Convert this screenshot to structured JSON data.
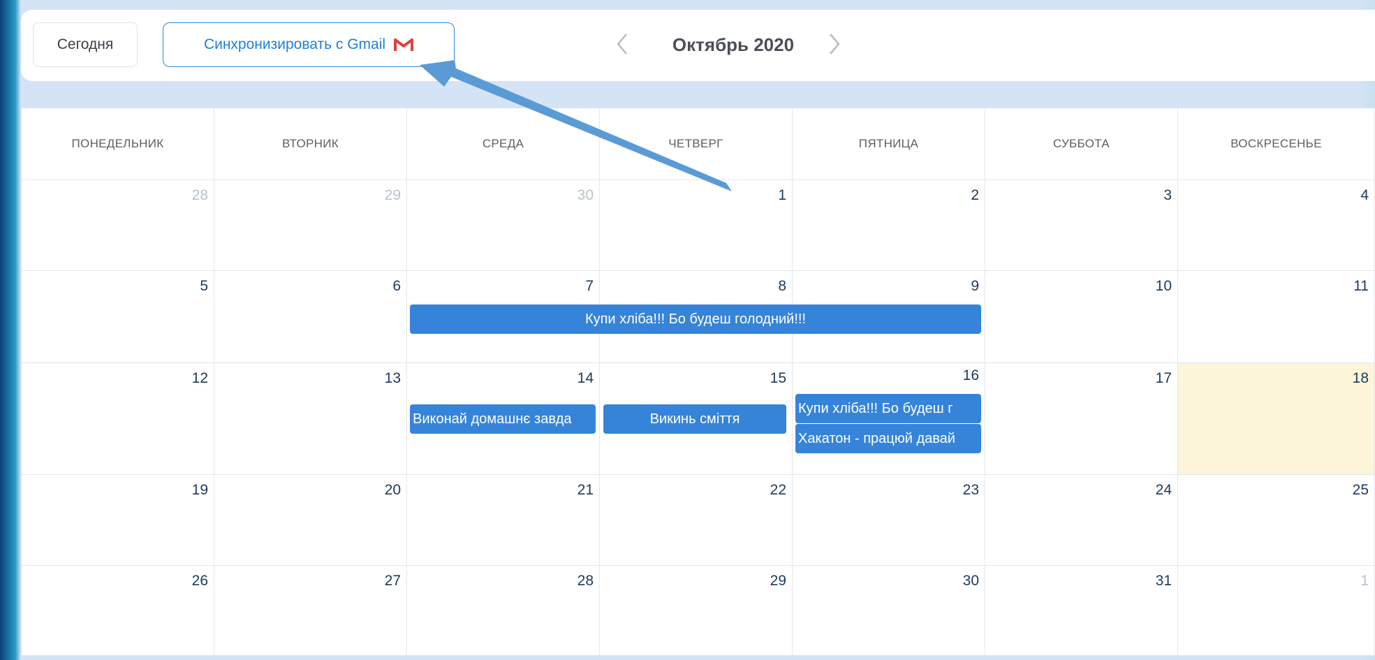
{
  "toolbar": {
    "today_label": "Сегодня",
    "sync_label": "Синхронизировать с Gmail",
    "sync_icon": "gmail-icon",
    "prev_icon": "chevron-left-icon",
    "next_icon": "chevron-right-icon",
    "month_title": "Октябрь 2020"
  },
  "weekdays": [
    "ПОНЕДЕЛЬНИК",
    "ВТОРНИК",
    "СРЕДА",
    "ЧЕТВЕРГ",
    "ПЯТНИЦА",
    "СУББОТА",
    "ВОСКРЕСЕНЬЕ"
  ],
  "weeks": [
    [
      "28",
      "29",
      "30",
      "1",
      "2",
      "3",
      "4"
    ],
    [
      "5",
      "6",
      "7",
      "8",
      "9",
      "10",
      "11"
    ],
    [
      "12",
      "13",
      "14",
      "15",
      "16",
      "17",
      "18"
    ],
    [
      "19",
      "20",
      "21",
      "22",
      "23",
      "24",
      "25"
    ],
    [
      "26",
      "27",
      "28",
      "29",
      "30",
      "31",
      "1"
    ]
  ],
  "events": {
    "bread_week2": "Купи хліба!!! Бо будеш голодний!!!",
    "homework": "Виконай домашнє завда",
    "trash": "Викинь сміття",
    "bread_16": "Купи хліба!!! Бо будеш г",
    "hackathon": "Хакатон - працюй давай"
  },
  "colors": {
    "accent": "#2b88e0",
    "event": "#3584d9",
    "today_bg": "#fdf5d9",
    "annotation_arrow": "#5b9bd5"
  }
}
